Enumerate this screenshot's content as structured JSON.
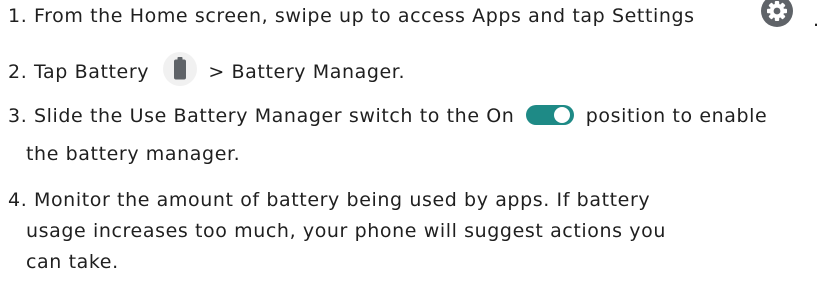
{
  "steps": [
    {
      "number": "1.",
      "text_before_icon": "From the Home screen, swipe up to access Apps and tap Settings",
      "icon": "settings-gear-icon",
      "text_after_icon": "."
    },
    {
      "number": "2.",
      "text_before_icon": "Tap Battery",
      "icon": "battery-icon",
      "text_after_icon": "> Battery Manager."
    },
    {
      "number": "3.",
      "text_before_icon": "Slide the Use Battery Manager switch to the On",
      "icon": "toggle-switch-on-icon",
      "text_after_icon": "position to enable",
      "continuation": "the battery manager."
    },
    {
      "number": "4.",
      "lines": [
        "Monitor the amount of battery being used by apps. If battery",
        "usage increases too much, your phone will suggest actions you",
        "can take."
      ]
    }
  ],
  "colors": {
    "toggle_track": "#1e8a86",
    "toggle_knob": "#ffffff",
    "icon_gray": "#5f6368",
    "text": "#1f1f1f"
  }
}
